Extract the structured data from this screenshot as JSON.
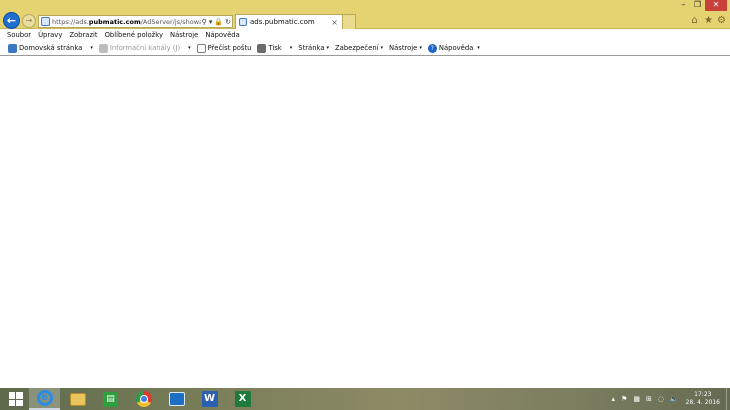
{
  "browser": {
    "address_url_prefix": "https://ads.",
    "address_url_domain": "pubmatic.com",
    "address_url_suffix": "/AdServer/js/showad.js",
    "address_controls": [
      "⚲ ▾",
      "🔒",
      "↻"
    ],
    "tab_title": "ads.pubmatic.com",
    "tab_close": "×",
    "back_glyph": "←",
    "forward_glyph": "→",
    "window_controls": {
      "minimize": "–",
      "maximize": "❐",
      "close": "✕"
    },
    "toolbar_icons": [
      "⌂",
      "★",
      "⚙"
    ]
  },
  "menu": {
    "items": [
      "Soubor",
      "Úpravy",
      "Zobrazit",
      "Oblíbené položky",
      "Nástroje",
      "Nápověda"
    ]
  },
  "command_bar": {
    "home": "Domovská stránka",
    "feeds": "Informační kanály (J)",
    "mail": "Přečíst poštu",
    "print": "Tisk",
    "page": "Stránka",
    "safety": "Zabezpečení",
    "tools": "Nástroje",
    "help": "Nápověda",
    "dropdown_glyph": "▾"
  },
  "taskbar": {
    "apps": [
      "windows-start-icon",
      "internet-explorer-icon",
      "file-explorer-icon",
      "store-icon",
      "chrome-icon",
      "remote-desktop-icon",
      "word-icon",
      "excel-icon"
    ],
    "word_letter": "W",
    "excel_letter": "X",
    "ie_letter": "e",
    "tray_glyphs": [
      "▴",
      "⚑",
      "▦",
      "⊞",
      "◌",
      "🔈"
    ],
    "time": "17:23",
    "date": "28. 4. 2016"
  },
  "colors": {
    "titlebar": "#e5d271",
    "accent_blue": "#1e6fd0",
    "close_red": "#c7403a"
  }
}
